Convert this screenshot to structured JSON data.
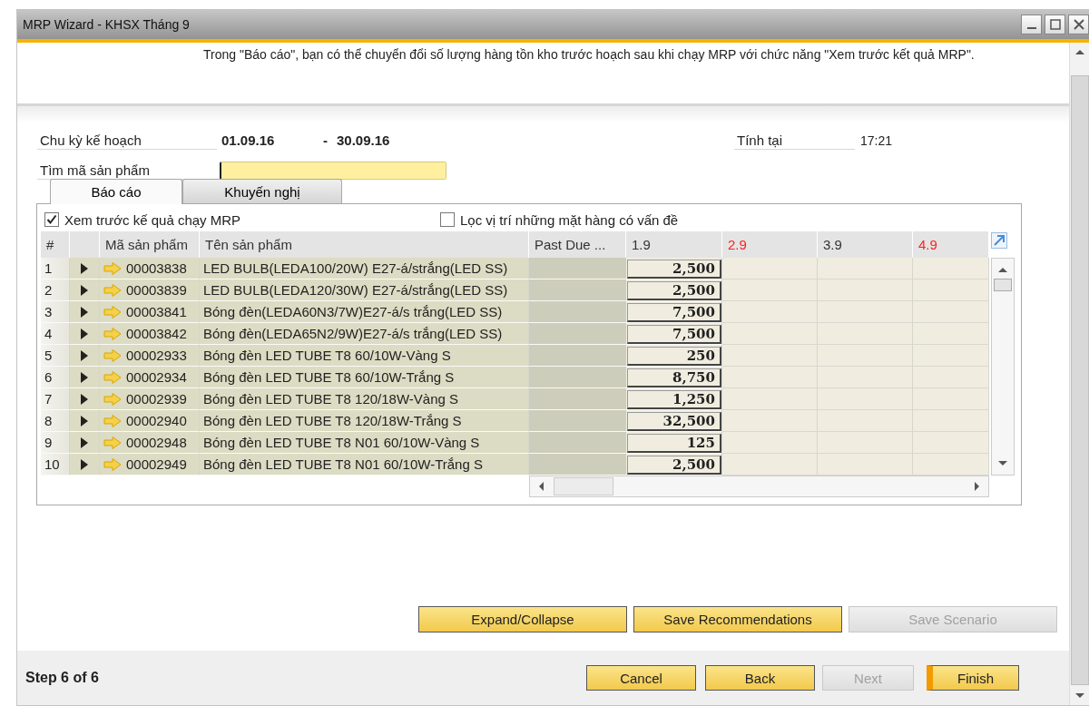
{
  "window": {
    "title": "MRP Wizard - KHSX Tháng 9"
  },
  "info_text": "Trong \"Báo cáo\", bạn có thể chuyển đổi số lượng hàng tồn kho trước hoạch sau khi chạy MRP với chức năng \"Xem trước kết quả MRP\".",
  "planning_period": {
    "label": "Chu kỳ kế hoạch",
    "from": "01.09.16",
    "separator": "-",
    "to": "30.09.16"
  },
  "calculated_at": {
    "label": "Tính tại",
    "value": "17:21"
  },
  "search": {
    "label": "Tìm mã sản phẩm"
  },
  "tabs": [
    {
      "label": "Báo cáo",
      "selected": true
    },
    {
      "label": "Khuyến nghị",
      "selected": false
    }
  ],
  "options": [
    {
      "label": "Xem trước kế quả chạy MRP",
      "checked": true
    },
    {
      "label": "Lọc vị trí những mặt hàng có vấn đề",
      "checked": false
    }
  ],
  "table": {
    "columns": [
      {
        "label": "#"
      },
      {
        "label": "Mã sản phẩm"
      },
      {
        "label": "Tên sản phẩm"
      },
      {
        "label": "Past Due ..."
      },
      {
        "label": "1.9",
        "color": "#333333"
      },
      {
        "label": "2.9",
        "color": "#ff2020"
      },
      {
        "label": "3.9",
        "color": "#333333"
      },
      {
        "label": "4.9",
        "color": "#ff2020"
      }
    ],
    "rows": [
      {
        "num": "1",
        "code": "00003838",
        "name": "LED BULB(LEDA100/20W) E27-á/strắng(LED SS)",
        "qty": "2,500"
      },
      {
        "num": "2",
        "code": "00003839",
        "name": "LED BULB(LEDA120/30W) E27-á/strắng(LED SS)",
        "qty": "2,500"
      },
      {
        "num": "3",
        "code": "00003841",
        "name": "Bóng đèn(LEDA60N3/7W)E27-á/s trắng(LED SS)",
        "qty": "7,500"
      },
      {
        "num": "4",
        "code": "00003842",
        "name": "Bóng đèn(LEDA65N2/9W)E27-á/s trắng(LED SS)",
        "qty": "7,500"
      },
      {
        "num": "5",
        "code": "00002933",
        "name": "Bóng đèn LED TUBE T8 60/10W-Vàng S",
        "qty": "250"
      },
      {
        "num": "6",
        "code": "00002934",
        "name": "Bóng đèn LED TUBE T8 60/10W-Trắng S",
        "qty": "8,750"
      },
      {
        "num": "7",
        "code": "00002939",
        "name": "Bóng đèn LED TUBE T8 120/18W-Vàng S",
        "qty": "1,250"
      },
      {
        "num": "8",
        "code": "00002940",
        "name": "Bóng đèn LED TUBE T8 120/18W-Trắng S",
        "qty": "32,500"
      },
      {
        "num": "9",
        "code": "00002948",
        "name": "Bóng đèn LED TUBE T8 N01 60/10W-Vàng S",
        "qty": "125"
      },
      {
        "num": "10",
        "code": "00002949",
        "name": "Bóng đèn LED TUBE T8 N01 60/10W-Trắng S",
        "qty": "2,500"
      }
    ]
  },
  "actions": [
    {
      "label": "Expand/Collapse",
      "disabled": false
    },
    {
      "label": "Save Recommendations",
      "disabled": false
    },
    {
      "label": "Save Scenario",
      "disabled": true
    }
  ],
  "step": "Step 6 of 6",
  "nav_buttons": [
    {
      "label": "Cancel",
      "disabled": false,
      "default": false
    },
    {
      "label": "Back",
      "disabled": false,
      "default": false
    },
    {
      "label": "Next",
      "disabled": true,
      "default": false
    },
    {
      "label": "Finish",
      "disabled": false,
      "default": true
    }
  ]
}
